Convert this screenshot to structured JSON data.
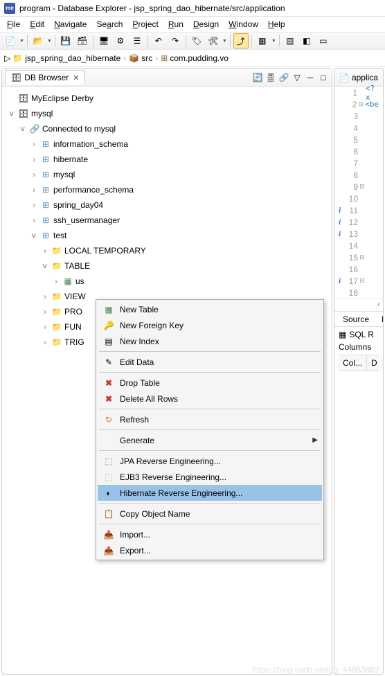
{
  "titlebar": {
    "text": "program - Database Explorer - jsp_spring_dao_hibernate/src/application"
  },
  "menubar": [
    "File",
    "Edit",
    "Navigate",
    "Search",
    "Project",
    "Run",
    "Design",
    "Window",
    "Help"
  ],
  "breadcrumb": {
    "items": [
      {
        "label": "jsp_spring_dao_hibernate"
      },
      {
        "label": "src"
      },
      {
        "label": "com.pudding.vo"
      }
    ]
  },
  "db_panel": {
    "title": "DB Browser",
    "tree": [
      {
        "indent": 0,
        "twisty": "",
        "icon": "🗄",
        "label": "MyEclipse Derby"
      },
      {
        "indent": 0,
        "twisty": "expanded",
        "icon": "🗄",
        "label": "mysql"
      },
      {
        "indent": 1,
        "twisty": "expanded",
        "icon": "🔗",
        "iconClass": "ic-green",
        "label": "Connected to mysql"
      },
      {
        "indent": 2,
        "twisty": "collapsed",
        "icon": "⊞",
        "iconClass": "ic-schema",
        "label": "information_schema"
      },
      {
        "indent": 2,
        "twisty": "collapsed",
        "icon": "⊞",
        "iconClass": "ic-schema",
        "label": "hibernate"
      },
      {
        "indent": 2,
        "twisty": "collapsed",
        "icon": "⊞",
        "iconClass": "ic-schema",
        "label": "mysql"
      },
      {
        "indent": 2,
        "twisty": "collapsed",
        "icon": "⊞",
        "iconClass": "ic-schema",
        "label": "performance_schema"
      },
      {
        "indent": 2,
        "twisty": "collapsed",
        "icon": "⊞",
        "iconClass": "ic-schema",
        "label": "spring_day04"
      },
      {
        "indent": 2,
        "twisty": "collapsed",
        "icon": "⊞",
        "iconClass": "ic-schema",
        "label": "ssh_usermanager"
      },
      {
        "indent": 2,
        "twisty": "expanded",
        "icon": "⊞",
        "iconClass": "ic-schema",
        "label": "test"
      },
      {
        "indent": 3,
        "twisty": "collapsed",
        "icon": "📁",
        "iconClass": "ic-folder",
        "label": "LOCAL TEMPORARY"
      },
      {
        "indent": 3,
        "twisty": "expanded",
        "icon": "📁",
        "iconClass": "ic-folder",
        "label": "TABLE"
      },
      {
        "indent": 4,
        "twisty": "collapsed",
        "icon": "▦",
        "iconClass": "ic-table",
        "label": "us"
      },
      {
        "indent": 3,
        "twisty": "collapsed",
        "icon": "📁",
        "iconClass": "ic-folder",
        "label": "VIEW"
      },
      {
        "indent": 3,
        "twisty": "collapsed",
        "icon": "📁",
        "iconClass": "ic-folder",
        "label": "PRO"
      },
      {
        "indent": 3,
        "twisty": "collapsed",
        "icon": "📁",
        "iconClass": "ic-folder",
        "label": "FUN"
      },
      {
        "indent": 3,
        "twisty": "collapsed",
        "icon": "📁",
        "iconClass": "ic-folder",
        "label": "TRIG"
      }
    ]
  },
  "editor": {
    "tab": "applica",
    "lines": [
      {
        "n": 1,
        "info": "",
        "fold": "",
        "code": "<?x",
        "cls": "xml-tag"
      },
      {
        "n": 2,
        "info": "",
        "fold": "⊟",
        "code": "<be",
        "cls": "xml-tag"
      },
      {
        "n": 3,
        "info": "",
        "fold": "",
        "code": "",
        "cls": ""
      },
      {
        "n": 4,
        "info": "",
        "fold": "",
        "code": "",
        "cls": ""
      },
      {
        "n": 5,
        "info": "",
        "fold": "",
        "code": "",
        "cls": ""
      },
      {
        "n": 6,
        "info": "",
        "fold": "",
        "code": "",
        "cls": ""
      },
      {
        "n": 7,
        "info": "",
        "fold": "",
        "code": "",
        "cls": ""
      },
      {
        "n": 8,
        "info": "",
        "fold": "",
        "code": "",
        "cls": ""
      },
      {
        "n": 9,
        "info": "",
        "fold": "⊟",
        "code": "",
        "cls": ""
      },
      {
        "n": 10,
        "info": "",
        "fold": "",
        "code": "",
        "cls": ""
      },
      {
        "n": 11,
        "info": "i",
        "fold": "",
        "code": "",
        "cls": ""
      },
      {
        "n": 12,
        "info": "i",
        "fold": "",
        "code": "",
        "cls": ""
      },
      {
        "n": 13,
        "info": "i",
        "fold": "",
        "code": "",
        "cls": ""
      },
      {
        "n": 14,
        "info": "",
        "fold": "",
        "code": "",
        "cls": ""
      },
      {
        "n": 15,
        "info": "",
        "fold": "⊟",
        "code": "",
        "cls": ""
      },
      {
        "n": 16,
        "info": "",
        "fold": "",
        "code": "",
        "cls": ""
      },
      {
        "n": 17,
        "info": "i",
        "fold": "⊟",
        "code": "",
        "cls": ""
      },
      {
        "n": 18,
        "info": "",
        "fold": "",
        "code": "",
        "cls": ""
      }
    ],
    "source_tab": "Source",
    "source_tab2": "N"
  },
  "sql_panel": {
    "title": "SQL R",
    "subtitle": "Columns",
    "cols": [
      "Col...",
      "D"
    ]
  },
  "context_menu": {
    "items": [
      {
        "icon": "▦",
        "iconClass": "ic-table",
        "label": "New Table"
      },
      {
        "icon": "🔑",
        "iconClass": "",
        "label": "New Foreign Key"
      },
      {
        "icon": "▤",
        "iconClass": "",
        "label": "New Index"
      },
      {
        "sep": true
      },
      {
        "icon": "✎",
        "iconClass": "",
        "label": "Edit Data"
      },
      {
        "sep": true
      },
      {
        "icon": "✖",
        "iconClass": "ic-red",
        "label": "Drop Table"
      },
      {
        "icon": "✖",
        "iconClass": "ic-red",
        "label": "Delete All Rows"
      },
      {
        "sep": true
      },
      {
        "icon": "↻",
        "iconClass": "ic-refresh",
        "label": "Refresh"
      },
      {
        "sep": true
      },
      {
        "icon": "",
        "iconClass": "",
        "label": "Generate",
        "arrow": "▶"
      },
      {
        "sep": true
      },
      {
        "icon": "⬚",
        "iconClass": "ic-green",
        "label": "JPA Reverse Engineering..."
      },
      {
        "icon": "⬚",
        "iconClass": "ic-db",
        "label": "EJB3 Reverse Engineering..."
      },
      {
        "icon": "◐",
        "iconClass": "",
        "label": "Hibernate Reverse Engineering...",
        "selected": true
      },
      {
        "sep": true
      },
      {
        "icon": "📋",
        "iconClass": "",
        "label": "Copy Object Name"
      },
      {
        "sep": true
      },
      {
        "icon": "📥",
        "iconClass": "",
        "label": "Import..."
      },
      {
        "icon": "📤",
        "iconClass": "",
        "label": "Export..."
      }
    ]
  },
  "watermark": "https://blog.csdn.net/qq_44853882"
}
